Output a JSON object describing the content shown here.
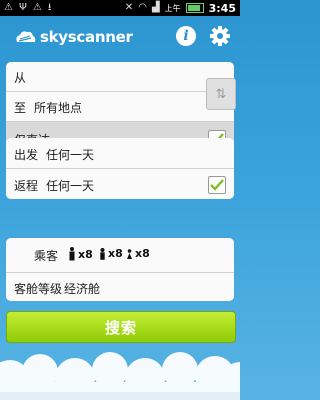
{
  "statusbar": {
    "time": "3:45",
    "ampm": "上午"
  },
  "header": {
    "brand": "skyscanner"
  },
  "route": {
    "from_label": "从",
    "to_label": "至",
    "to_value": "所有地点",
    "direct_label": "仅直达",
    "direct_checked": true
  },
  "dates": {
    "depart_label": "出发",
    "depart_value": "任何一天",
    "return_label": "返程",
    "return_value": "任何一天",
    "return_checked": true
  },
  "passengers": {
    "label": "乘客",
    "adults": "x8",
    "children": "x8",
    "infants": "x8",
    "class_label": "客舱等级",
    "class_value": "经济舱"
  },
  "search_label": "搜索",
  "colors": {
    "accent": "#2c94cf",
    "search": "#a6dc1a",
    "check": "#7cbf22"
  }
}
